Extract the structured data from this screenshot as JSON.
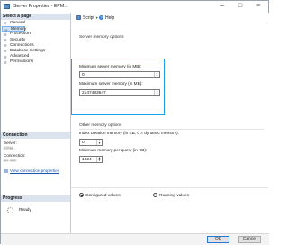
{
  "window": {
    "title": "Server Properties - EPM..."
  },
  "left_pane": {
    "select_page_header": "Select a page",
    "pages": [
      {
        "label": "General",
        "selected": false
      },
      {
        "label": "Memory",
        "selected": true
      },
      {
        "label": "Processors",
        "selected": false
      },
      {
        "label": "Security",
        "selected": false
      },
      {
        "label": "Connections",
        "selected": false
      },
      {
        "label": "Database Settings",
        "selected": false
      },
      {
        "label": "Advanced",
        "selected": false
      },
      {
        "label": "Permissions",
        "selected": false
      }
    ],
    "connection_header": "Connection",
    "server_label": "Server:",
    "server_value": "EPM...",
    "connection_label": "Connection:",
    "connection_value": "••• ••••",
    "view_connection_link": "View connection properties",
    "progress_header": "Progress",
    "progress_status": "Ready"
  },
  "toolbar": {
    "script_label": "Script",
    "help_label": "Help"
  },
  "main": {
    "server_memory_section": "Server memory options",
    "min_memory_label": "Minimum server memory (in MB):",
    "min_memory_value": "0",
    "max_memory_label": "Maximum server memory (in MB):",
    "max_memory_value": "2147483647",
    "other_memory_section": "Other memory options",
    "index_memory_label": "Index creation memory (in KB, 0 = dynamic memory):",
    "index_memory_value": "0",
    "min_query_label": "Minimum memory per query (in KB):",
    "min_query_value": "1024",
    "radio_configured": "Configured values",
    "radio_running": "Running values",
    "selected_radio": "configured"
  },
  "buttons": {
    "ok": "OK",
    "cancel": "Cancel"
  },
  "colors": {
    "highlight_border": "#1aa3e8",
    "selected_page_bg": "#cfe2f7",
    "link": "#1b57b1"
  }
}
